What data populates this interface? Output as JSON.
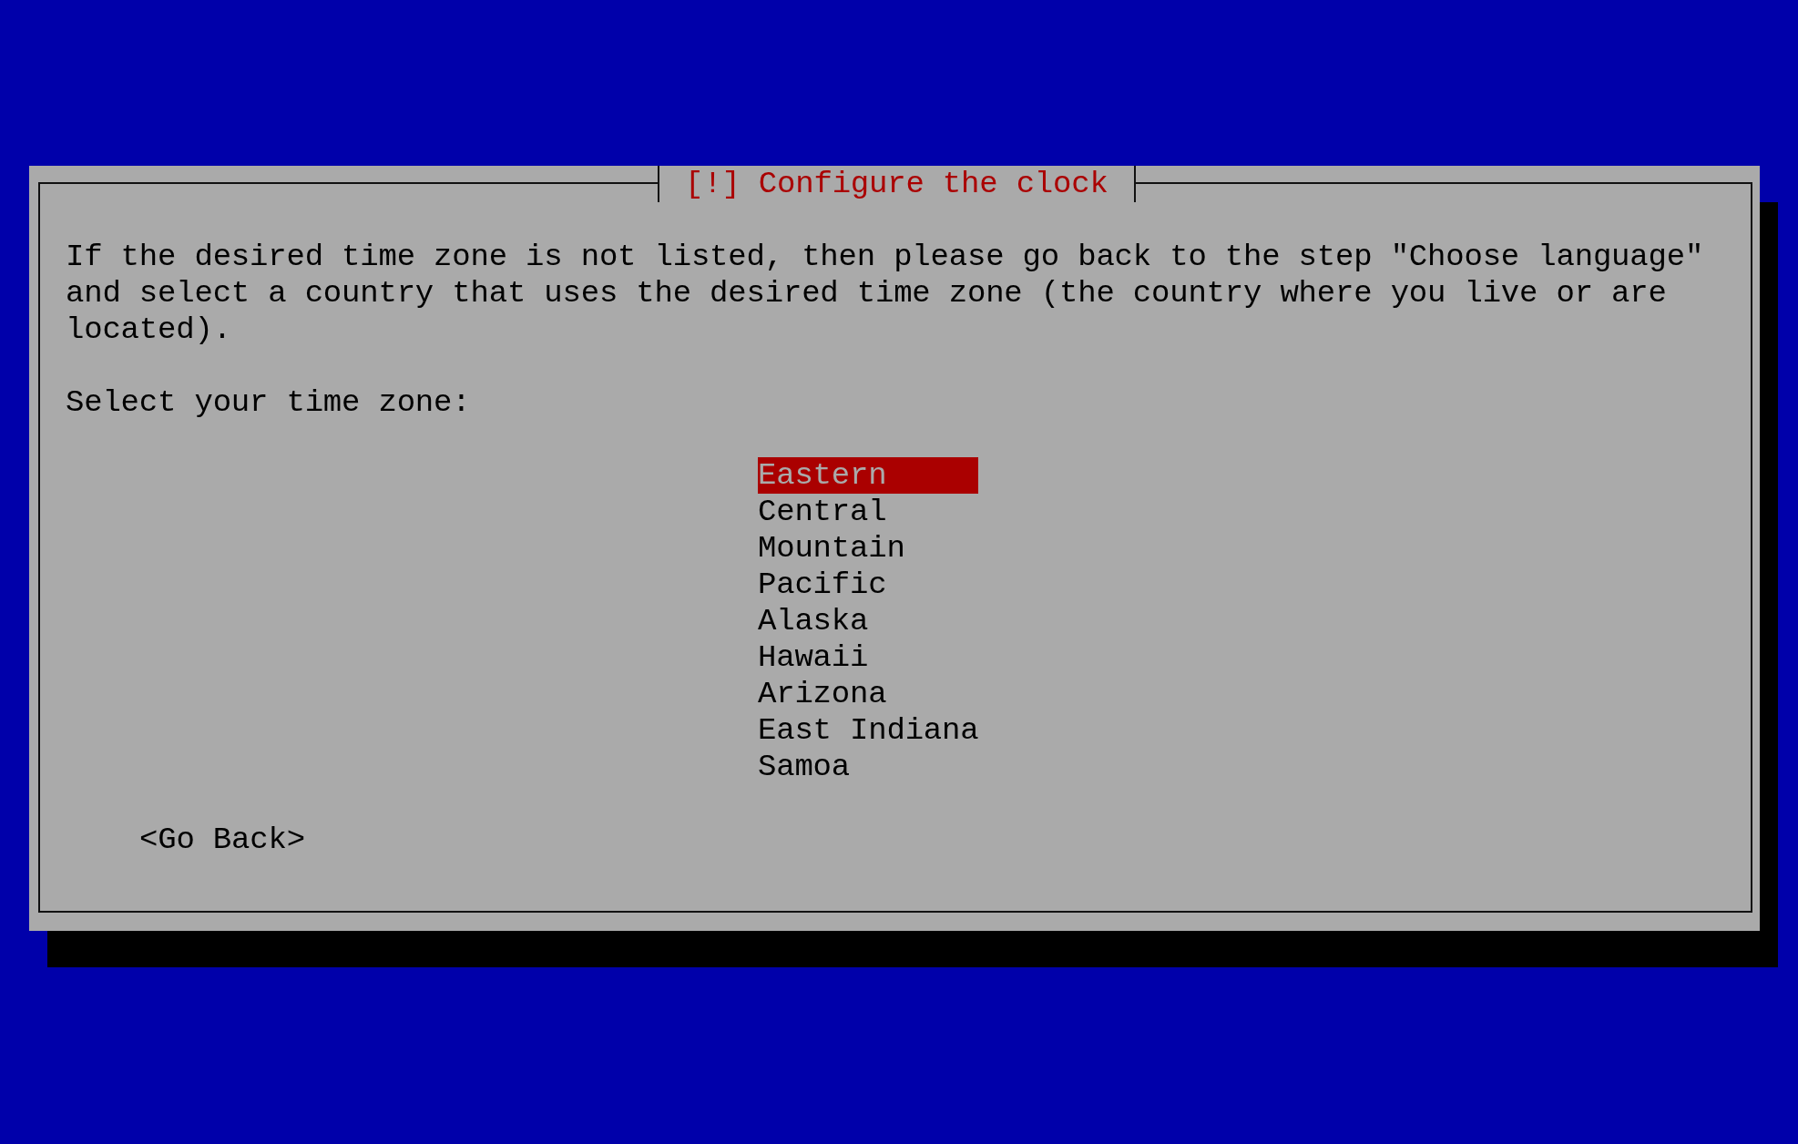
{
  "dialog": {
    "title": "[!] Configure the clock",
    "message": "If the desired time zone is not listed, then please go back to the step \"Choose language\" and select a country that uses the desired time zone (the country where you live or are located).",
    "prompt": "Select your time zone:",
    "options": [
      {
        "label": "Eastern",
        "selected": true
      },
      {
        "label": "Central",
        "selected": false
      },
      {
        "label": "Mountain",
        "selected": false
      },
      {
        "label": "Pacific",
        "selected": false
      },
      {
        "label": "Alaska",
        "selected": false
      },
      {
        "label": "Hawaii",
        "selected": false
      },
      {
        "label": "Arizona",
        "selected": false
      },
      {
        "label": "East Indiana",
        "selected": false
      },
      {
        "label": "Samoa",
        "selected": false
      }
    ],
    "buttons": [
      "<Go Back>"
    ]
  }
}
